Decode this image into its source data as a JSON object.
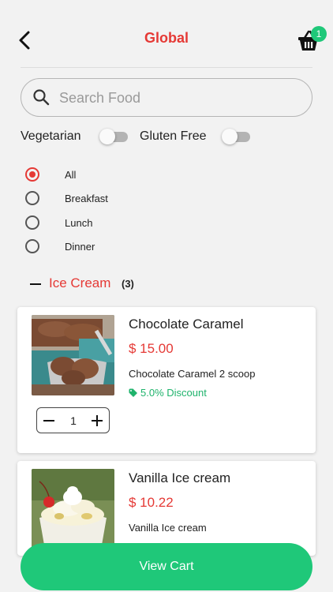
{
  "header": {
    "title": "Global",
    "cart_count": "1"
  },
  "search": {
    "placeholder": "Search Food",
    "value": ""
  },
  "filters": {
    "vegetarian_label": "Vegetarian",
    "vegetarian_on": false,
    "gluten_free_label": "Gluten Free",
    "gluten_free_on": false
  },
  "meal_types": [
    {
      "label": "All",
      "selected": true
    },
    {
      "label": "Breakfast",
      "selected": false
    },
    {
      "label": "Lunch",
      "selected": false
    },
    {
      "label": "Dinner",
      "selected": false
    }
  ],
  "category": {
    "name": "Ice Cream",
    "count": "(3)"
  },
  "items": [
    {
      "name": "Chocolate Caramel",
      "price": "$ 15.00",
      "description": "Chocolate Caramel 2 scoop",
      "discount": "5.0% Discount",
      "quantity": "1"
    },
    {
      "name": "Vanilla Ice cream",
      "price": "$ 10.22",
      "description": "Vanilla Ice cream"
    }
  ],
  "footer": {
    "view_cart_label": "View Cart"
  },
  "colors": {
    "accent_red": "#e53935",
    "accent_green": "#1fc879",
    "background": "#f2f2f2"
  }
}
